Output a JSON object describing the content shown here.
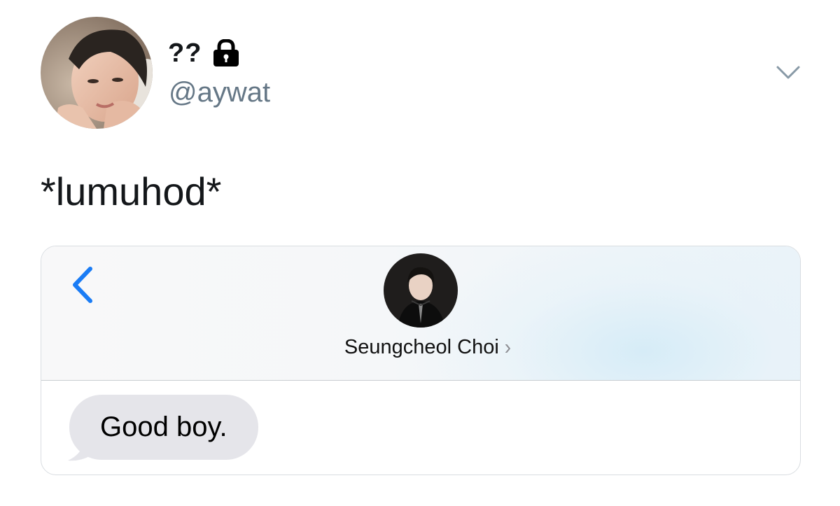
{
  "tweet": {
    "display_name": "??",
    "handle": "@aywat",
    "text": "*lumuhod*",
    "icons": {
      "lock": "lock-icon",
      "menu": "chevron-down-icon"
    }
  },
  "message_screenshot": {
    "contact_name": "Seungcheol Choi",
    "contact_chevron": "›",
    "messages": [
      {
        "direction": "incoming",
        "text": "Good boy."
      }
    ],
    "colors": {
      "accent_blue": "#1a7cf5",
      "bubble_gray": "#e5e5ea"
    },
    "icons": {
      "back": "chevron-left-icon"
    }
  }
}
